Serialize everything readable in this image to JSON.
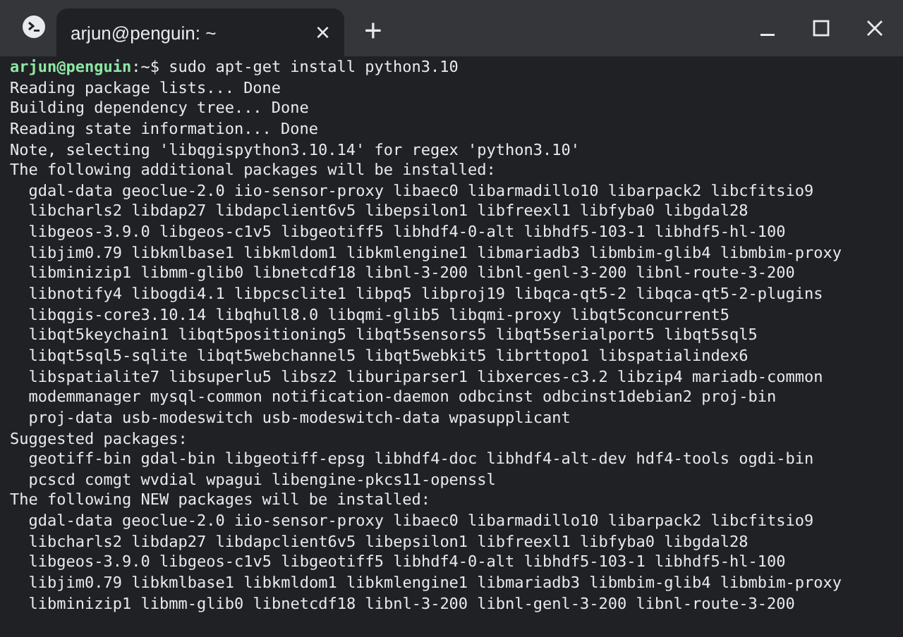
{
  "tab": {
    "title": "arjun@penguin: ~",
    "close": "×",
    "selected": true
  },
  "new_tab": "+",
  "prompt": {
    "user_host": "arjun@penguin",
    "path": ":~$",
    "command": "sudo apt-get install python3.10"
  },
  "lines": [
    {
      "text": "Reading package lists... Done",
      "indented": false
    },
    {
      "text": "Building dependency tree... Done",
      "indented": false
    },
    {
      "text": "Reading state information... Done",
      "indented": false
    },
    {
      "text": "Note, selecting 'libqgispython3.10.14' for regex 'python3.10'",
      "indented": false
    },
    {
      "text": "The following additional packages will be installed:",
      "indented": false
    },
    {
      "text": "gdal-data geoclue-2.0 iio-sensor-proxy libaec0 libarmadillo10 libarpack2 libcfitsio9",
      "indented": true
    },
    {
      "text": "libcharls2 libdap27 libdapclient6v5 libepsilon1 libfreexl1 libfyba0 libgdal28",
      "indented": true
    },
    {
      "text": "libgeos-3.9.0 libgeos-c1v5 libgeotiff5 libhdf4-0-alt libhdf5-103-1 libhdf5-hl-100",
      "indented": true
    },
    {
      "text": "libjim0.79 libkmlbase1 libkmldom1 libkmlengine1 libmariadb3 libmbim-glib4 libmbim-proxy",
      "indented": true
    },
    {
      "text": "libminizip1 libmm-glib0 libnetcdf18 libnl-3-200 libnl-genl-3-200 libnl-route-3-200",
      "indented": true
    },
    {
      "text": "libnotify4 libogdi4.1 libpcsclite1 libpq5 libproj19 libqca-qt5-2 libqca-qt5-2-plugins",
      "indented": true
    },
    {
      "text": "libqgis-core3.10.14 libqhull8.0 libqmi-glib5 libqmi-proxy libqt5concurrent5",
      "indented": true
    },
    {
      "text": "libqt5keychain1 libqt5positioning5 libqt5sensors5 libqt5serialport5 libqt5sql5",
      "indented": true
    },
    {
      "text": "libqt5sql5-sqlite libqt5webchannel5 libqt5webkit5 librttopo1 libspatialindex6",
      "indented": true
    },
    {
      "text": "libspatialite7 libsuperlu5 libsz2 liburiparser1 libxerces-c3.2 libzip4 mariadb-common",
      "indented": true
    },
    {
      "text": "modemmanager mysql-common notification-daemon odbcinst odbcinst1debian2 proj-bin",
      "indented": true
    },
    {
      "text": "proj-data usb-modeswitch usb-modeswitch-data wpasupplicant",
      "indented": true
    },
    {
      "text": "Suggested packages:",
      "indented": false
    },
    {
      "text": "geotiff-bin gdal-bin libgeotiff-epsg libhdf4-doc libhdf4-alt-dev hdf4-tools ogdi-bin",
      "indented": true
    },
    {
      "text": "pcscd comgt wvdial wpagui libengine-pkcs11-openssl",
      "indented": true
    },
    {
      "text": "The following NEW packages will be installed:",
      "indented": false
    },
    {
      "text": "gdal-data geoclue-2.0 iio-sensor-proxy libaec0 libarmadillo10 libarpack2 libcfitsio9",
      "indented": true
    },
    {
      "text": "libcharls2 libdap27 libdapclient6v5 libepsilon1 libfreexl1 libfyba0 libgdal28",
      "indented": true
    },
    {
      "text": "libgeos-3.9.0 libgeos-c1v5 libgeotiff5 libhdf4-0-alt libhdf5-103-1 libhdf5-hl-100",
      "indented": true
    },
    {
      "text": "libjim0.79 libkmlbase1 libkmldom1 libkmlengine1 libmariadb3 libmbim-glib4 libmbim-proxy",
      "indented": true
    },
    {
      "text": "libminizip1 libmm-glib0 libnetcdf18 libnl-3-200 libnl-genl-3-200 libnl-route-3-200",
      "indented": true
    }
  ]
}
